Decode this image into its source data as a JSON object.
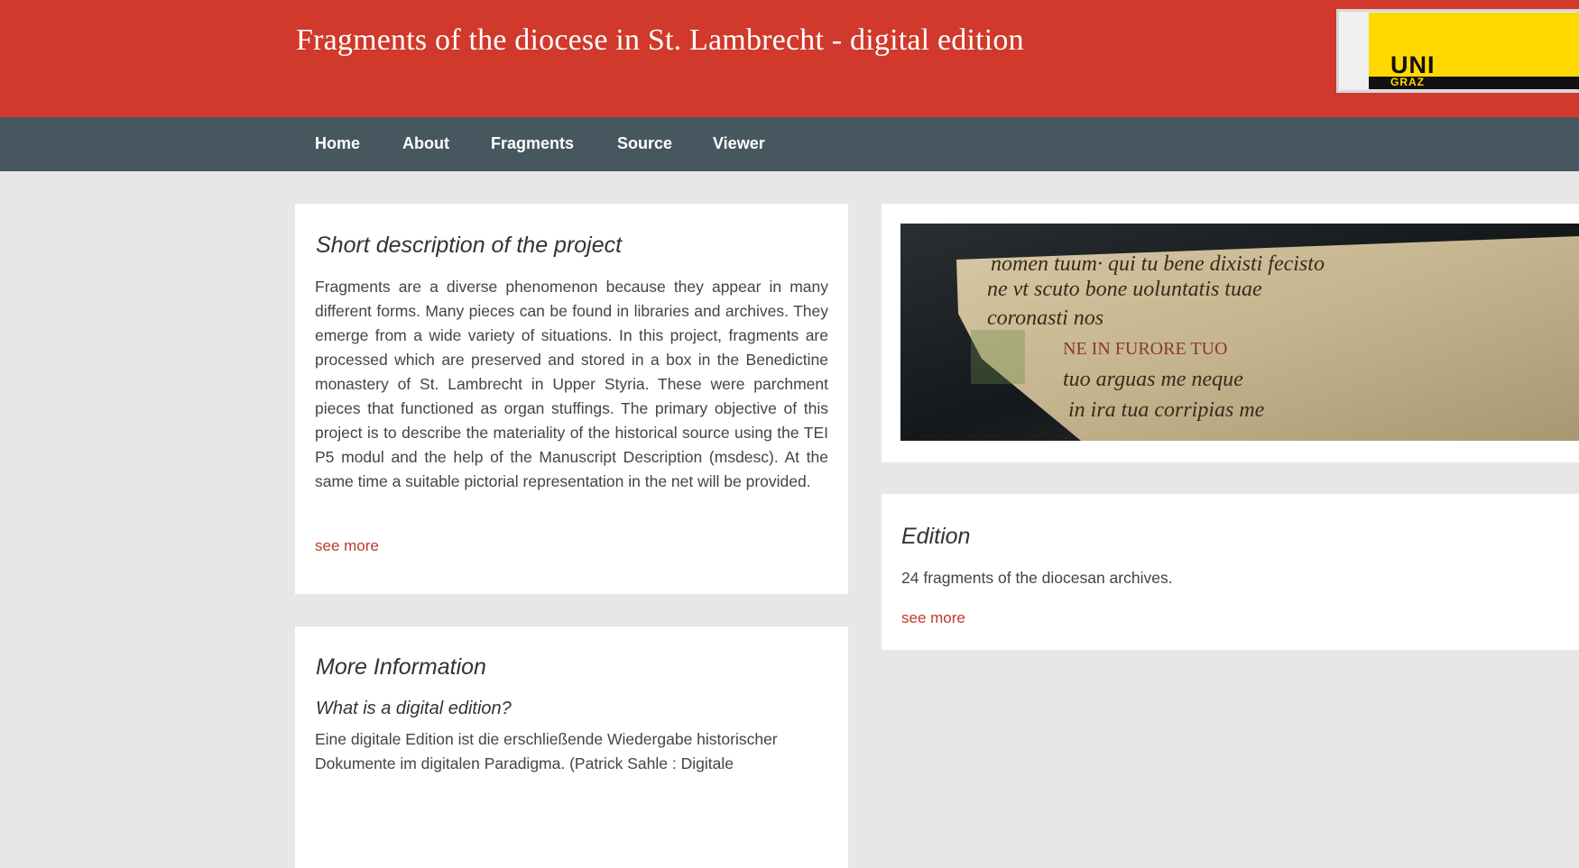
{
  "header": {
    "title": "Fragments of the diocese in St. Lambrecht - digital edition",
    "logo_text": "UNI",
    "logo_subtext": "GRAZ"
  },
  "nav": {
    "items": [
      {
        "label": "Home"
      },
      {
        "label": "About"
      },
      {
        "label": "Fragments"
      },
      {
        "label": "Source"
      },
      {
        "label": "Viewer"
      }
    ]
  },
  "description_card": {
    "title": "Short description of the project",
    "body": "Fragments are a diverse phenomenon because they appear in many different forms. Many pieces can be found in libraries and archives. They emerge from a wide variety of situations. In this project, fragments are processed which are preserved and stored in a box in the Benedictine monastery of St. Lambrecht in Upper Styria. These were parchment pieces that functioned as organ stuffings. The primary objective of this project is to describe the materiality of the historical source using the TEI P5 modul and the help of the Manuscript Description (msdesc). At the same time a suitable pictorial representation in the net will be provided.",
    "link": "see more"
  },
  "more_info_card": {
    "title": "More Information",
    "subtitle": "What is a digital edition?",
    "body": "Eine digitale Edition ist die erschließende Wiedergabe historischer Dokumente im digitalen Paradigma. (Patrick Sahle : Digitale"
  },
  "edition_card": {
    "title": "Edition",
    "body": "24 fragments of the diocesan archives.",
    "link": "see more"
  },
  "photo": {
    "lines": [
      "nomen tuum· qui tu bene dixisti fecisto",
      "ne vt scuto bone uoluntatis tuae",
      "coronasti nos",
      "NE IN FURORE TUO",
      "tuo arguas me neque",
      "in ira tua corripias me"
    ]
  },
  "colors": {
    "header": "#d0392b",
    "nav": "#465760",
    "background": "#e7e7e7",
    "link": "#c0392b"
  }
}
